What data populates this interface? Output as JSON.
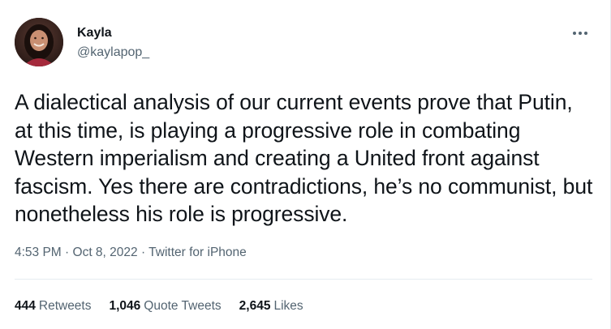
{
  "user": {
    "display_name": "Kayla",
    "handle": "@kaylapop_"
  },
  "tweet": {
    "text": "A dialectical analysis of our current events prove that Putin, at this time, is playing a progressive role in combating Western imperialism and creating a United front against fascism. Yes there are contradictions, he’s no communist, but nonetheless his role is progressive."
  },
  "meta": {
    "time": "4:53 PM",
    "separator": "·",
    "date": "Oct 8, 2022",
    "source": "Twitter for iPhone"
  },
  "stats": {
    "retweets_count": "444",
    "retweets_label": "Retweets",
    "quotes_count": "1,046",
    "quotes_label": "Quote Tweets",
    "likes_count": "2,645",
    "likes_label": "Likes"
  },
  "icons": {
    "more": "more-horizontal-icon"
  },
  "colors": {
    "text_primary": "#0f1419",
    "text_secondary": "#536471",
    "divider": "#e6ecf0"
  }
}
